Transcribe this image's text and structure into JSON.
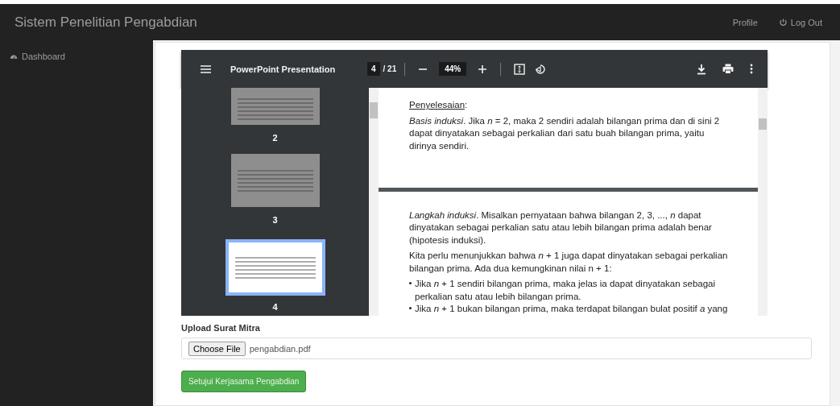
{
  "navbar": {
    "brand": "Sistem Penelitian Pengabdian",
    "links": [
      {
        "label": "Profile",
        "kind": "text"
      },
      {
        "label": "Log Out",
        "kind": "power"
      }
    ]
  },
  "sidebar": {
    "items": [
      {
        "label": "Dashboard"
      }
    ]
  },
  "pdf_viewer": {
    "title": "PowerPoint Presentation",
    "page_input": "4",
    "page_total": "/ 21",
    "zoom": "44%",
    "thumbnails": [
      {
        "label": "2",
        "selected": false
      },
      {
        "label": "3",
        "selected": false
      },
      {
        "label": "4",
        "selected": true
      }
    ],
    "pages": [
      {
        "blocks": [
          {
            "kind": "heading",
            "text": "Penyelesaian",
            "suffix": ":"
          },
          {
            "kind": "paragraph",
            "text": "*Basis induksi*. Jika *n* = 2, maka 2 sendiri adalah bilangan prima dan di sini 2 dapat dinyatakan sebagai perkalian dari satu buah bilangan prima, yaitu dirinya sendiri."
          }
        ]
      },
      {
        "blocks": [
          {
            "kind": "paragraph",
            "text": "*Langkah induksi*. Misalkan pernyataan bahwa bilangan 2, 3, ..., *n* dapat dinyatakan sebagai perkalian satu atau lebih bilangan prima adalah benar (hipotesis induksi)."
          },
          {
            "kind": "paragraph",
            "text": "Kita perlu menunjukkan bahwa *n* + 1 juga dapat dinyatakan sebagai perkalian bilangan prima. Ada dua kemungkinan nilai n + 1:"
          },
          {
            "kind": "bullet",
            "text": "Jika *n* + 1 sendiri bilangan prima, maka jelas ia dapat dinyatakan sebagai perkalian satu atau lebih bilangan prima."
          },
          {
            "kind": "bullet",
            "text": "Jika *n* + 1 bukan bilangan prima, maka terdapat bilangan bulat positif *a* yang"
          }
        ]
      }
    ]
  },
  "upload": {
    "label": "Upload Surat Mitra",
    "choose_button": "Choose File",
    "filename": "pengabdian.pdf"
  },
  "submit_button": "Setujui Kerjasama Pengabdian"
}
